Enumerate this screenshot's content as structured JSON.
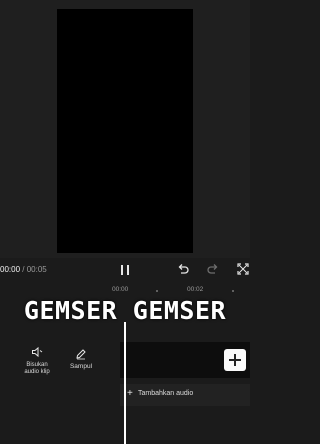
{
  "playback": {
    "current_time": "00:00",
    "separator": " / ",
    "total_time": "00:05"
  },
  "ruler": {
    "labels": [
      "00:00",
      "00:02"
    ]
  },
  "overlay": {
    "title": "GEMSER GEMSER"
  },
  "tools": [
    {
      "label": "Bisukan audio klip",
      "icon": "speaker-mute-icon"
    },
    {
      "label": "Sampul",
      "icon": "pencil-icon"
    }
  ],
  "timeline": {
    "add_audio_label": "Tambahkan audio",
    "add_audio_symbol": "+"
  },
  "icons": [
    "pause-icon",
    "undo-icon",
    "redo-icon",
    "fullscreen-icon",
    "add-icon"
  ],
  "colors": {
    "background": "#1b1b1b",
    "preview": "#000000",
    "playhead": "#ffffff",
    "add_button": "#fafafa"
  }
}
